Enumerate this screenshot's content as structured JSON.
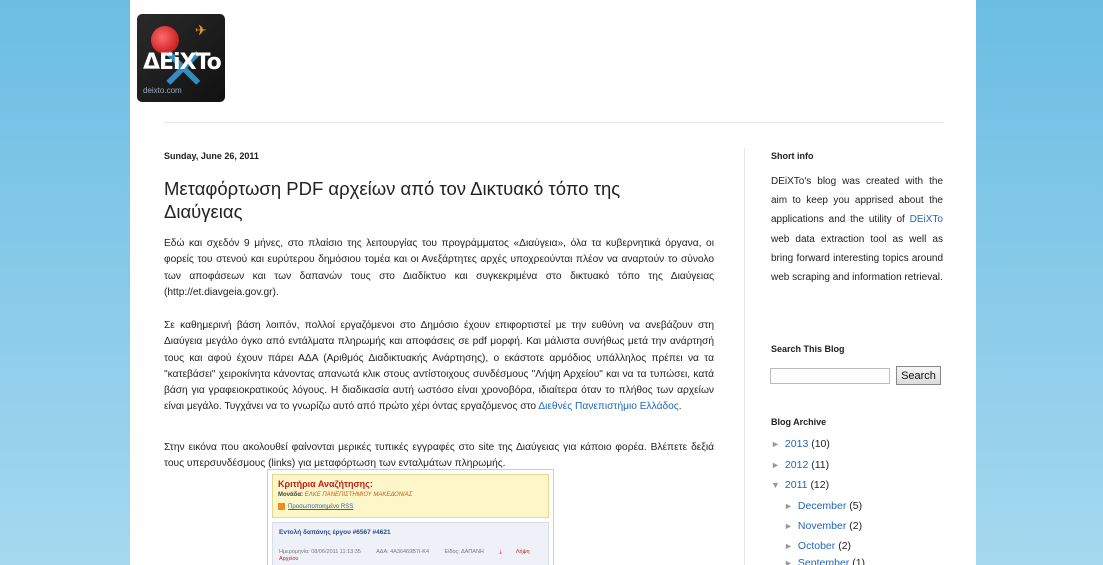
{
  "logo": {
    "brand": "ΔEiXTo",
    "url": "deixto.com"
  },
  "post": {
    "date": "Sunday, June 26, 2011",
    "title": "Μεταφόρτωση PDF αρχείων από τον Δικτυακό τόπο της Διαύγειας",
    "p1": "Εδώ και σχεδόν 9 μήνες, στο πλαίσιο της λειτουργίας του προγράμματος «Διαύγεια», όλα τα κυβερνητικά όργανα, οι φορείς του στενού και ευρύτερου δημόσιου τομέα και οι Ανεξάρτητες αρχές υποχρεούνται πλέον να αναρτούν το σύνολο των αποφάσεων και των δαπανών τους στο Διαδίκτυο και συγκεκριμένα στο δικτυακό τόπο της Διαύγειας (http://et.diavgeia.gov.gr).",
    "p2_text": "Σε καθημερινή βάση λοιπόν, πολλοί εργαζόμενοι στο Δημόσιο έχουν επιφορτιστεί με την ευθύνη να ανεβάζουν στη Διαύγεια μεγάλο όγκο από εντάλματα πληρωμής και αποφάσεις σε pdf μορφή. Και μάλιστα συνήθως μετά την ανάρτησή τους και αφού έχουν πάρει ΑΔΑ (Αριθμός Διαδικτυακής Ανάρτησης), ο εκάστοτε αρμόδιος υπάλληλος πρέπει να τα \"κατεβάσει\" χειροκίνητα κάνοντας απανωτά κλικ στους αντίστοιχους συνδέσμους \"Λήψη Αρχείου\" και να τα τυπώσει, κατά βάση για γραφειοκρατικούς λόγους. Η διαδικασία αυτή ωστόσο είναι χρονοβόρα, ιδιαίτερα όταν το πλήθος των αρχείων είναι μεγάλο. Τυγχάνει να το γνωρίζω αυτό από πρώτο χέρι όντας εργαζόμενος στο ",
    "p2_link": "Διεθνές Πανεπιστήμιο Ελλάδος",
    "p2_end": ".",
    "p3": "Στην εικόνα που ακολουθεί φαίνονται μερικές τυπικές εγγραφές στο site της Διαύγειας για κάποιο φορέα. Βλέπετε δεξιά τους υπερσυνδέσμους (links) για μεταφόρτωση των ενταλμάτων πληρωμής."
  },
  "embed": {
    "criteria_title": "Κριτήρια Αναζήτησης:",
    "unit_label": "Μονάδα:",
    "unit_value": "ΕΛΚΕ ΠΑΝΕΠΙΣΤΗΜΙΟΥ ΜΑΚΕΔΟΝΙΑΣ",
    "rss": "Προσωποποιημένο RSS",
    "record_title": "Εντολή δαπάνης έργου #6567 #4621",
    "record_date": "Ημερομηνία: 08/06/2011 11:13:35",
    "record_ada": "ΑΔΑ: 4Α36469Β7Ι-Κ4",
    "record_type": "Είδος: ΔΑΠΑΝΗ",
    "record_download": "Λήψη Αρχείου"
  },
  "sidebar": {
    "short_info_title": "Short info",
    "short_info_pre": "DEiXTo's blog was created with the aim to keep you apprised about the applications and the utility of ",
    "short_info_link": "DEiXTo",
    "short_info_post": " web data extraction tool as well as bring forward interesting topics around web scraping and information retrieval.",
    "search_title": "Search This Blog",
    "search_button": "Search",
    "archive_title": "Blog Archive",
    "archive": [
      {
        "tri": "►",
        "label": "2013",
        "count": "(10)"
      },
      {
        "tri": "►",
        "label": "2012",
        "count": "(11)"
      },
      {
        "tri": "▼",
        "label": "2011",
        "count": "(12)"
      },
      {
        "tri": "►",
        "label": "December",
        "count": "(5)"
      },
      {
        "tri": "►",
        "label": "November",
        "count": "(2)"
      },
      {
        "tri": "►",
        "label": "October",
        "count": "(2)"
      },
      {
        "tri": "►",
        "label": "September",
        "count": "(1)"
      }
    ]
  }
}
